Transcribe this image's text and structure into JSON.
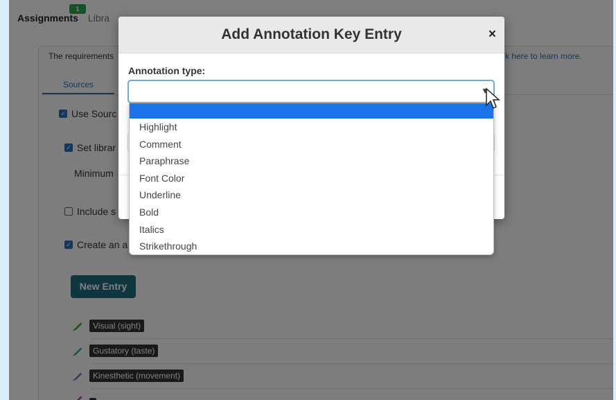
{
  "top_nav": {
    "assignments": "Assignments",
    "libraries": "Libra",
    "badge": "1"
  },
  "page": {
    "requirements_text": "The requirements",
    "learn_more_text": "k here to learn more.",
    "sources_tab": "Sources",
    "use_sources": "Use Sourc",
    "set_library": "Set librar",
    "minimum": "Minimum",
    "include": "Include s",
    "create": "Create an a",
    "new_entry_button": "New Entry",
    "entries": [
      {
        "label": "Visual (sight)",
        "color": "#2e9e2e"
      },
      {
        "label": "Gustatory (taste)",
        "color": "#2aa6a0"
      },
      {
        "label": "Kinesthetic (movement)",
        "color": "#8a6bb0"
      },
      {
        "label": "",
        "color": "#b03aa5"
      }
    ]
  },
  "modal": {
    "title": "Add Annotation Key Entry",
    "close": "×",
    "annotation_type_label": "Annotation type:",
    "annotation_type_value": "",
    "dropdown_options": [
      "",
      "Highlight",
      "Comment",
      "Paraphrase",
      "Font Color",
      "Underline",
      "Bold",
      "Italics",
      "Strikethrough"
    ]
  },
  "colors": {
    "accent": "#1a73e8",
    "new_entry_bg": "#1e6c7d",
    "overlay": "rgba(0,0,0,0.5)"
  }
}
